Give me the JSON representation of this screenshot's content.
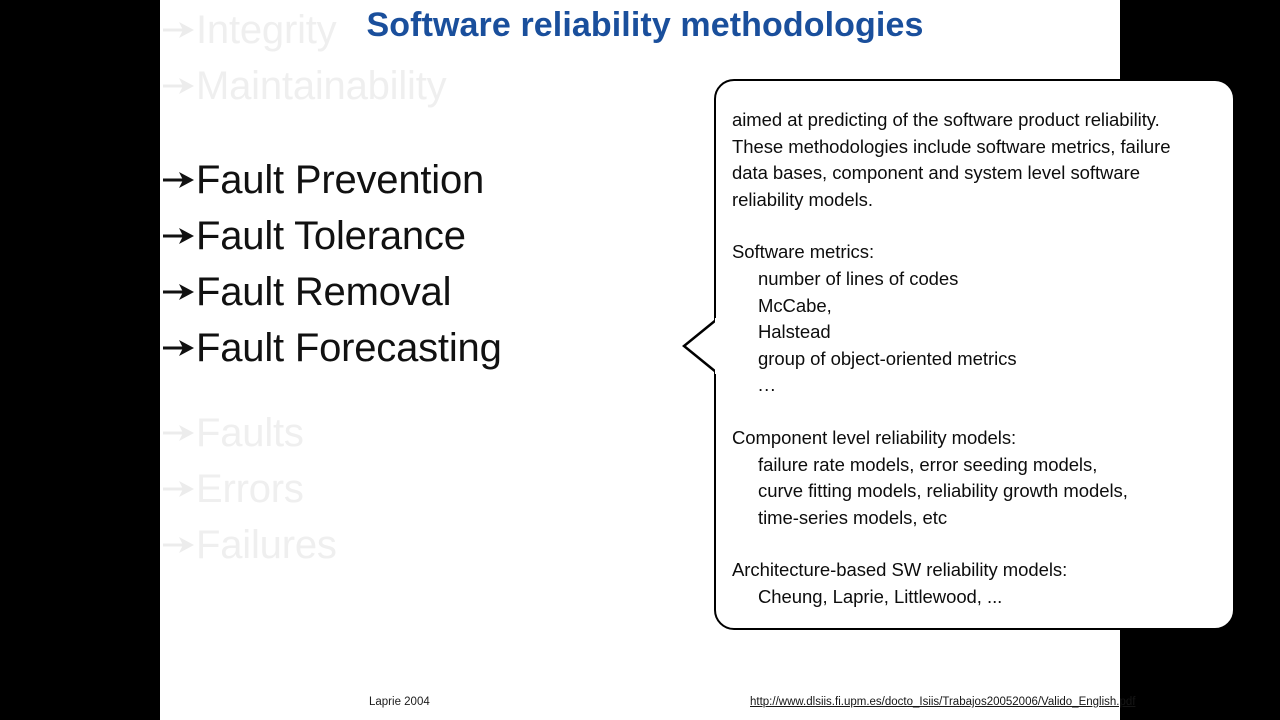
{
  "slide": {
    "title": "Software reliability methodologies"
  },
  "bullets": {
    "top_faded": [
      {
        "label": "Integrity",
        "icon": "arrow-bullet-icon",
        "state": "faded"
      },
      {
        "label": "Maintainability",
        "icon": "arrow-bullet-icon",
        "state": "faded"
      }
    ],
    "main": [
      {
        "label": "Fault Prevention",
        "icon": "arrow-bullet-icon",
        "state": "active"
      },
      {
        "label": "Fault Tolerance",
        "icon": "arrow-bullet-icon",
        "state": "active"
      },
      {
        "label": "Fault Removal",
        "icon": "arrow-bullet-icon",
        "state": "active"
      },
      {
        "label": "Fault Forecasting",
        "icon": "arrow-bullet-icon",
        "state": "active"
      }
    ],
    "bottom_faded": [
      {
        "label": "Faults",
        "icon": "arrow-bullet-icon",
        "state": "faded"
      },
      {
        "label": "Errors",
        "icon": "arrow-bullet-icon",
        "state": "faded"
      },
      {
        "label": "Failures",
        "icon": "arrow-bullet-icon",
        "state": "faded"
      }
    ]
  },
  "callout": {
    "intro_lines": [
      "aimed at predicting of the software product reliability.",
      "These methodologies include software metrics, failure",
      "data bases, component and system level software",
      "reliability models."
    ],
    "sections": [
      {
        "heading": "Software metrics:",
        "items": [
          "number of lines of codes",
          "McCabe,",
          "Halstead",
          "group of object-oriented metrics"
        ],
        "trailing": "..."
      },
      {
        "heading": "Component level reliability models:",
        "items": [
          "failure rate models, error seeding models,",
          "curve fitting models, reliability growth models,",
          "time-series models, etc"
        ],
        "trailing": ""
      },
      {
        "heading": "Architecture-based SW reliability models:",
        "items": [
          "Cheung, Laprie, Littlewood, ..."
        ],
        "trailing": ""
      }
    ]
  },
  "footer": {
    "citation": "Laprie 2004",
    "link": "http://www.dlsiis.fi.upm.es/docto_Isiis/Trabajos20052006/Valido_English.pdf"
  },
  "colors": {
    "title_blue": "#1a4f9c",
    "text_black": "#0d0d0d",
    "faded_gray": "#efefef",
    "letterbox": "#000000",
    "canvas": "#ffffff"
  }
}
